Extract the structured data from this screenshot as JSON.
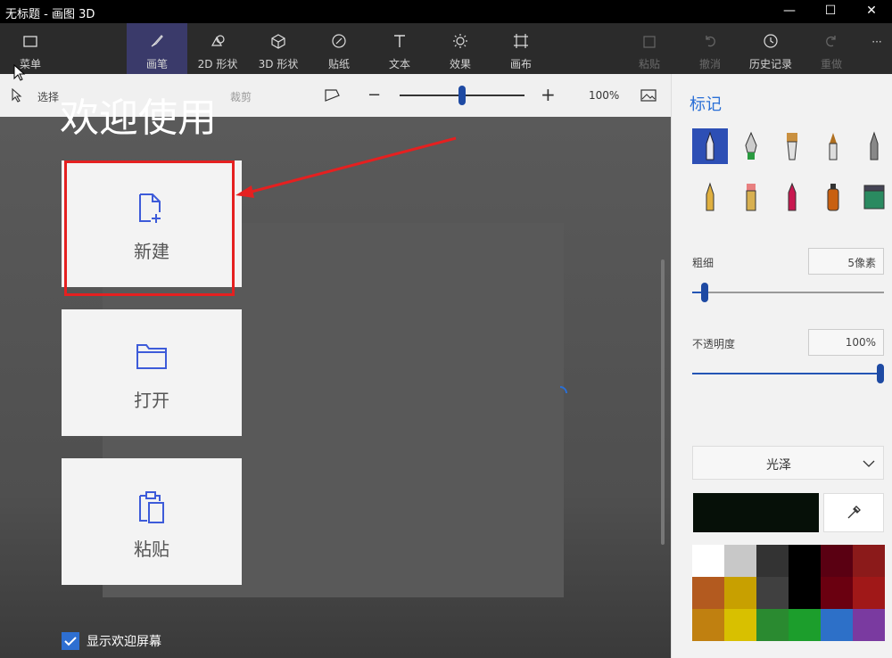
{
  "window": {
    "title": "无标题 - 画图 3D",
    "minimize": "—",
    "maximize": "☐",
    "close": "✕"
  },
  "toolbar": {
    "menu": "菜单",
    "brushes": "画笔",
    "shapes2d": "2D 形状",
    "shapes3d": "3D 形状",
    "stickers": "贴纸",
    "text": "文本",
    "effects": "效果",
    "canvas": "画布",
    "paste": "粘贴",
    "undo": "撤消",
    "history": "历史记录",
    "redo": "重做",
    "more": "···"
  },
  "subbar": {
    "select": "选择",
    "crop": "裁剪",
    "zoom": "100%"
  },
  "welcome": {
    "title": "欢迎使用",
    "new_label": "新建",
    "open_label": "打开",
    "paste_label": "粘贴",
    "show_welcome": "显示欢迎屏幕",
    "show_welcome_checked": true
  },
  "panel": {
    "title": "标记",
    "thickness_label": "粗细",
    "thickness_value": "5像素",
    "thickness_level": 0.05,
    "opacity_label": "不透明度",
    "opacity_value": "100%",
    "opacity_level": 1.0,
    "finish": "光泽",
    "current_color": "#061008",
    "palette": [
      "#ffffff",
      "#c8c8c8",
      "#333333",
      "#000000",
      "#5a0012",
      "#8b1a1a",
      "#b35a1f",
      "#c8a000",
      "#404040",
      "#000000",
      "#6a0010",
      "#a01818",
      "#c08010",
      "#d8c000",
      "#2a8a30",
      "#1c9e2c",
      "#2d70c8",
      "#7a3aa0"
    ]
  },
  "colors": {
    "accent": "#2a6fd6",
    "annotation": "#e52020",
    "icon_blue": "#3d5bd9"
  }
}
